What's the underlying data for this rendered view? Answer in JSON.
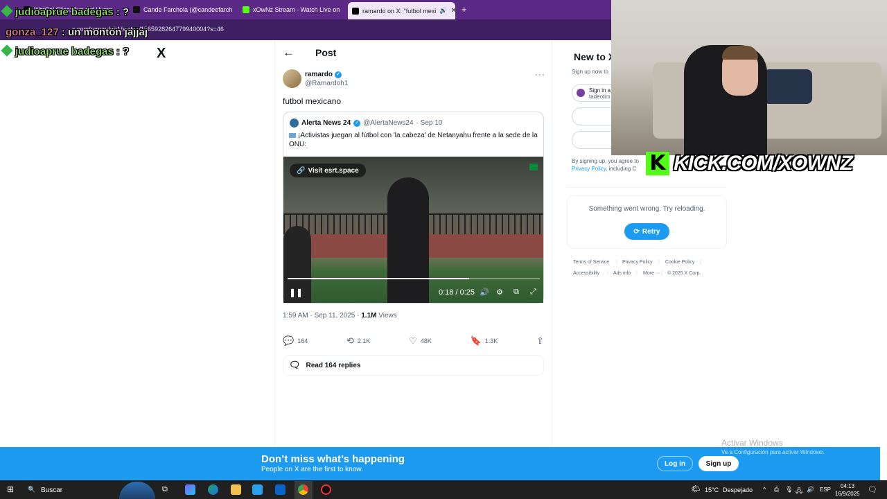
{
  "browser": {
    "tabs": [
      {
        "label": "WatCol Clips: Jug ard Hump"
      },
      {
        "label": "Cande Farchola (@candeefarch"
      },
      {
        "label": "xOwNz Stream - Watch Live on"
      },
      {
        "label": "ramardo on X: \"futbol mexi"
      }
    ],
    "new_tab": "+",
    "url": "x.com/ramardoh1/status/1965928264779940004?s=46"
  },
  "chat": [
    {
      "user": "judioaprue badegas",
      "sep": ":",
      "message": "?"
    },
    {
      "user": "gonza_127",
      "sep": ":",
      "message": "un montón jajjaj"
    },
    {
      "user": "judioaprue badegas",
      "sep": ":",
      "message": "?"
    }
  ],
  "x": {
    "logo": "X",
    "back": "←",
    "page_title": "Post",
    "author_name": "ramardo",
    "author_handle": "@Ramardoh1",
    "more": "···",
    "text": "futbol mexicano",
    "quote": {
      "name": "Alerta News 24",
      "handle": "@AlertaNews24",
      "date": "· Sep 10",
      "text": "¡Activistas juegan al fútbol con 'la cabeza' de Netanyahu frente a la sede de la ONU:",
      "visit": "Visit esrt.space",
      "time": "0:18 / 0:25",
      "progress": 0.72
    },
    "meta_time": "1:59 AM · Sep 11, 2025 ·",
    "views_count": "1.1M",
    "views_label": "Views",
    "actions": {
      "replies": "164",
      "reposts": "2.1K",
      "likes": "48K",
      "bookmarks": "1.3K"
    },
    "read_replies": "Read 164 replies"
  },
  "sidebar": {
    "new_to": "New to X?",
    "signup_now": "Sign up now to",
    "signin": "Sign in a",
    "signin_sub": "tadeotim",
    "terms_1": "By signing up, you agree to",
    "terms_2": "Privacy Policy",
    "terms_3": ", including C",
    "error": "Something went wrong. Try reloading.",
    "retry": "Retry",
    "footer": [
      "Terms of Service",
      "Privacy Policy",
      "Cookie Policy",
      "Accessibility",
      "Ads info",
      "More ···",
      "© 2025 X Corp."
    ]
  },
  "overlay": {
    "kick_text": "KICK.COM/XOWNZ",
    "kick_logo": "K"
  },
  "banner": {
    "title": "Don’t miss what’s happening",
    "subtitle": "People on X are the first to know.",
    "login": "Log in",
    "signup": "Sign up"
  },
  "windows": {
    "activate": "Activar Windows",
    "activate_sub": "Ve a Configuración para activar Windows.",
    "search": "Buscar",
    "weather_temp": "15°C",
    "weather_text": "Despejado",
    "lang": "ESP",
    "time": "04:13",
    "date": "16/9/2025"
  }
}
